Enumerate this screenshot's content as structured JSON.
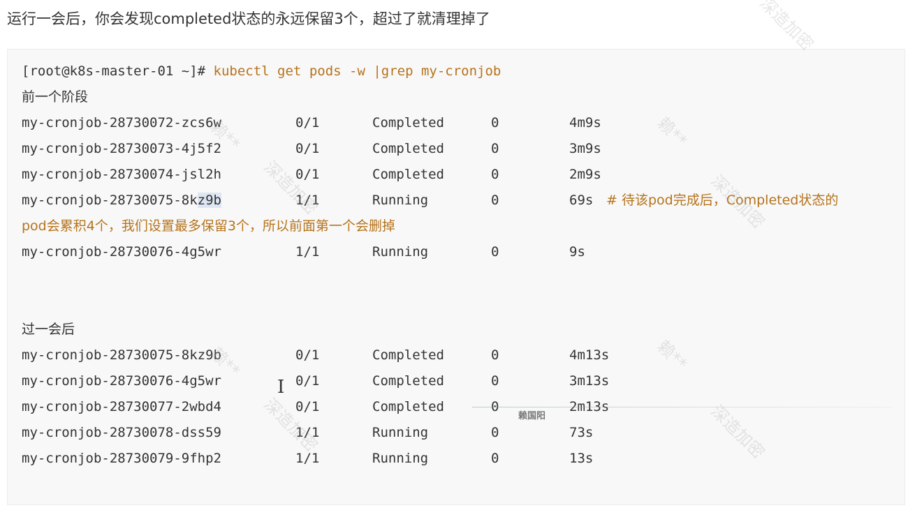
{
  "intro_text": "运行一会后，你会发现completed状态的永远保留3个，超过了就清理掉了",
  "code": {
    "prompt": "[root@k8s-master-01 ~]# ",
    "command": "kubectl get pods -w |grep my-cronjob",
    "section1_label": "前一个阶段",
    "section1_rows": [
      {
        "name": "my-cronjob-28730072-zcs6w",
        "ready": "0/1",
        "status": "Completed",
        "restarts": "0",
        "age": "4m9s"
      },
      {
        "name": "my-cronjob-28730073-4j5f2",
        "ready": "0/1",
        "status": "Completed",
        "restarts": "0",
        "age": "3m9s"
      },
      {
        "name": "my-cronjob-28730074-jsl2h",
        "ready": "0/1",
        "status": "Completed",
        "restarts": "0",
        "age": "2m9s"
      },
      {
        "name_prefix": "my-cronjob-28730075-8k",
        "name_selected": "z9b",
        "ready": "1/1",
        "status": "Running",
        "restarts": "0",
        "age": "69s",
        "comment": "# 待该pod完成后，Completed状态的"
      },
      {
        "comment_continuation": "pod会累积4个，我们设置最多保留3个，所以前面第一个会删掉"
      },
      {
        "name": "my-cronjob-28730076-4g5wr",
        "ready": "1/1",
        "status": "Running",
        "restarts": "0",
        "age": "9s"
      }
    ],
    "section2_label": "过一会后",
    "section2_rows": [
      {
        "name": "my-cronjob-28730075-8kz9b",
        "ready": "0/1",
        "status": "Completed",
        "restarts": "0",
        "age": "4m13s"
      },
      {
        "name": "my-cronjob-28730076-4g5wr",
        "ready": "0/1",
        "status": "Completed",
        "restarts": "0",
        "age": "3m13s"
      },
      {
        "name": "my-cronjob-28730077-2wbd4",
        "ready": "0/1",
        "status": "Completed",
        "restarts": "0",
        "age": "2m13s"
      },
      {
        "name": "my-cronjob-28730078-dss59",
        "ready": "1/1",
        "status": "Running",
        "restarts": "0",
        "age": "73s"
      },
      {
        "name": "my-cronjob-28730079-9fhp2",
        "ready": "1/1",
        "status": "Running",
        "restarts": "0",
        "age": "13s"
      }
    ]
  },
  "overlay_badge": "赖国阳",
  "watermarks": [
    "赖**",
    "深造加密"
  ],
  "colors": {
    "comment": "#b5731c",
    "code_bg": "#f8f8f8",
    "text": "#333333",
    "selection": "#dde6f2"
  }
}
